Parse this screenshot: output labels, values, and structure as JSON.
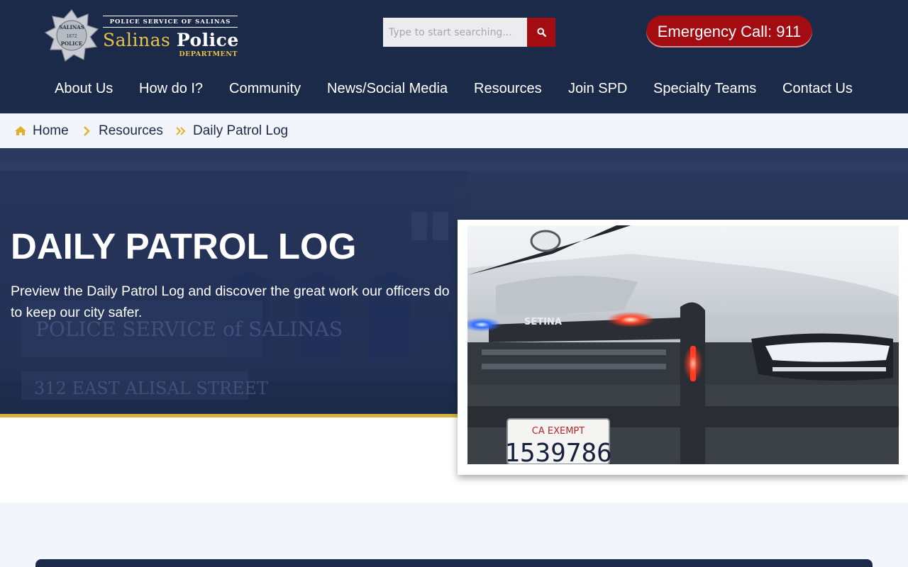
{
  "header": {
    "logo": {
      "badge_text_top": "SALINAS",
      "badge_year": "1872",
      "badge_text_bottom": "POLICE",
      "tagline": "POLICE SERVICE OF SALINAS",
      "name_part1": "Salinas",
      "name_part2": "Police",
      "department": "DEPARTMENT"
    },
    "search": {
      "placeholder": "Type to start searching...",
      "icon": "search-icon"
    },
    "emergency_label": "Emergency Call: 911",
    "nav": [
      "About Us",
      "How do I?",
      "Community",
      "News/Social Media",
      "Resources",
      "Join SPD",
      "Specialty Teams",
      "Contact Us"
    ]
  },
  "breadcrumb": {
    "home_icon": "home-icon",
    "items": [
      "Home",
      "Resources",
      "Daily Patrol Log"
    ]
  },
  "hero": {
    "title": "DAILY PATROL LOG",
    "description": "Preview the Daily Patrol Log and discover the great work our officers do to keep our city safer.",
    "bg_sign_line1": "POLICE SERVICE of SALINAS",
    "bg_sign_line2": "312 EAST ALISAL STREET",
    "photo": {
      "car_grille_text": "SETINA",
      "plate_top": "CA EXEMPT",
      "plate_number": "1539786"
    }
  },
  "colors": {
    "navy": "#1c2a4a",
    "red": "#a30d12",
    "gold": "#d4b43c",
    "light_bg": "#f2f6fc"
  }
}
